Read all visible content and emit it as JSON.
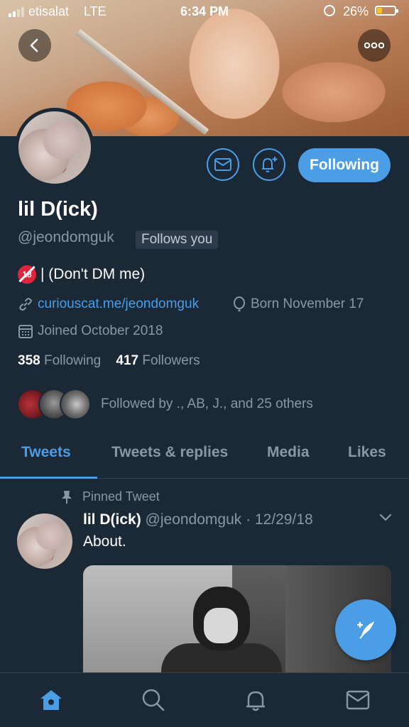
{
  "status_bar": {
    "carrier": "etisalat",
    "network": "LTE",
    "time": "6:34 PM",
    "battery": "26%"
  },
  "profile": {
    "name": "lil D(ick)",
    "handle": "@jeondomguk",
    "follows_you": "Follows you",
    "bio": "| (Don't DM me)",
    "bio_badge": "18",
    "link": "curiouscat.me/jeondomguk",
    "birthday": "Born November 17",
    "joined": "Joined October 2018",
    "following_count": "358",
    "following_label": "Following",
    "followers_count": "417",
    "followers_label": "Followers",
    "followed_by": "Followed by ., AB, J., and 25 others",
    "follow_button": "Following"
  },
  "tabs": [
    {
      "label": "Tweets",
      "active": true
    },
    {
      "label": "Tweets & replies",
      "active": false
    },
    {
      "label": "Media",
      "active": false
    },
    {
      "label": "Likes",
      "active": false
    }
  ],
  "pinned_tweet": {
    "pinned_label": "Pinned Tweet",
    "author": "lil D(ick)",
    "handle": "@jeondomguk",
    "date": "· 12/29/18",
    "text": "About."
  },
  "colors": {
    "background": "#1b2836",
    "accent": "#4b9ee6",
    "muted": "#8899a6"
  },
  "icons": {
    "back": "back-arrow-icon",
    "more": "more-icon",
    "message": "envelope-icon",
    "notify": "bell-plus-icon",
    "link": "link-icon",
    "birthday": "balloon-icon",
    "joined": "calendar-icon",
    "pin": "pin-icon",
    "compose": "compose-icon",
    "home": "home-icon",
    "search": "search-icon",
    "notifications": "bell-icon",
    "messages": "mail-icon"
  }
}
